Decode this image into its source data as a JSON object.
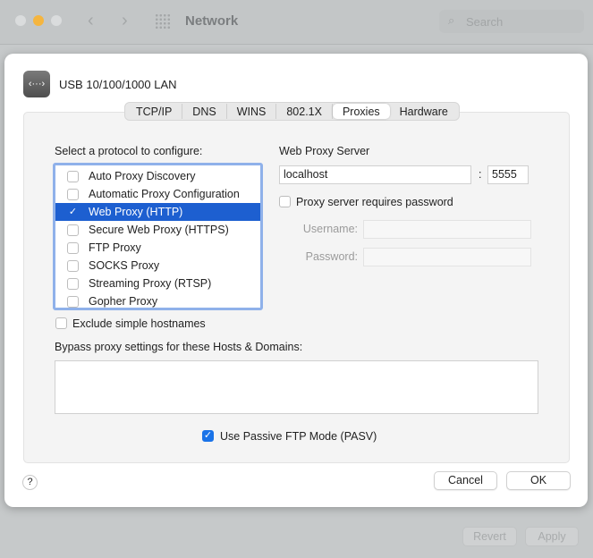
{
  "window": {
    "title": "Network",
    "search_placeholder": "Search",
    "revert": "Revert",
    "apply": "Apply"
  },
  "sheet": {
    "device_name": "USB 10/100/1000 LAN",
    "tabs": [
      {
        "label": "TCP/IP"
      },
      {
        "label": "DNS"
      },
      {
        "label": "WINS"
      },
      {
        "label": "802.1X"
      },
      {
        "label": "Proxies",
        "selected": true
      },
      {
        "label": "Hardware"
      }
    ],
    "protocol_label": "Select a protocol to configure:",
    "protocols": [
      {
        "label": "Auto Proxy Discovery",
        "checked": false
      },
      {
        "label": "Automatic Proxy Configuration",
        "checked": false
      },
      {
        "label": "Web Proxy (HTTP)",
        "checked": true,
        "selected": true
      },
      {
        "label": "Secure Web Proxy (HTTPS)",
        "checked": false
      },
      {
        "label": "FTP Proxy",
        "checked": false
      },
      {
        "label": "SOCKS Proxy",
        "checked": false
      },
      {
        "label": "Streaming Proxy (RTSP)",
        "checked": false
      },
      {
        "label": "Gopher Proxy",
        "checked": false
      }
    ],
    "server_label": "Web Proxy Server",
    "server": "localhost",
    "colon": ":",
    "port": "5555",
    "requires_password": "Proxy server requires password",
    "username_label": "Username:",
    "password_label": "Password:",
    "exclude_simple": "Exclude simple hostnames",
    "bypass_label": "Bypass proxy settings for these Hosts & Domains:",
    "bypass_value": "",
    "passive_ftp": "Use Passive FTP Mode (PASV)",
    "passive_ftp_checked": true,
    "help": "?",
    "cancel": "Cancel",
    "ok": "OK"
  },
  "colors": {
    "accent": "#1d5fd0",
    "checkbox": "#1a73e8"
  }
}
